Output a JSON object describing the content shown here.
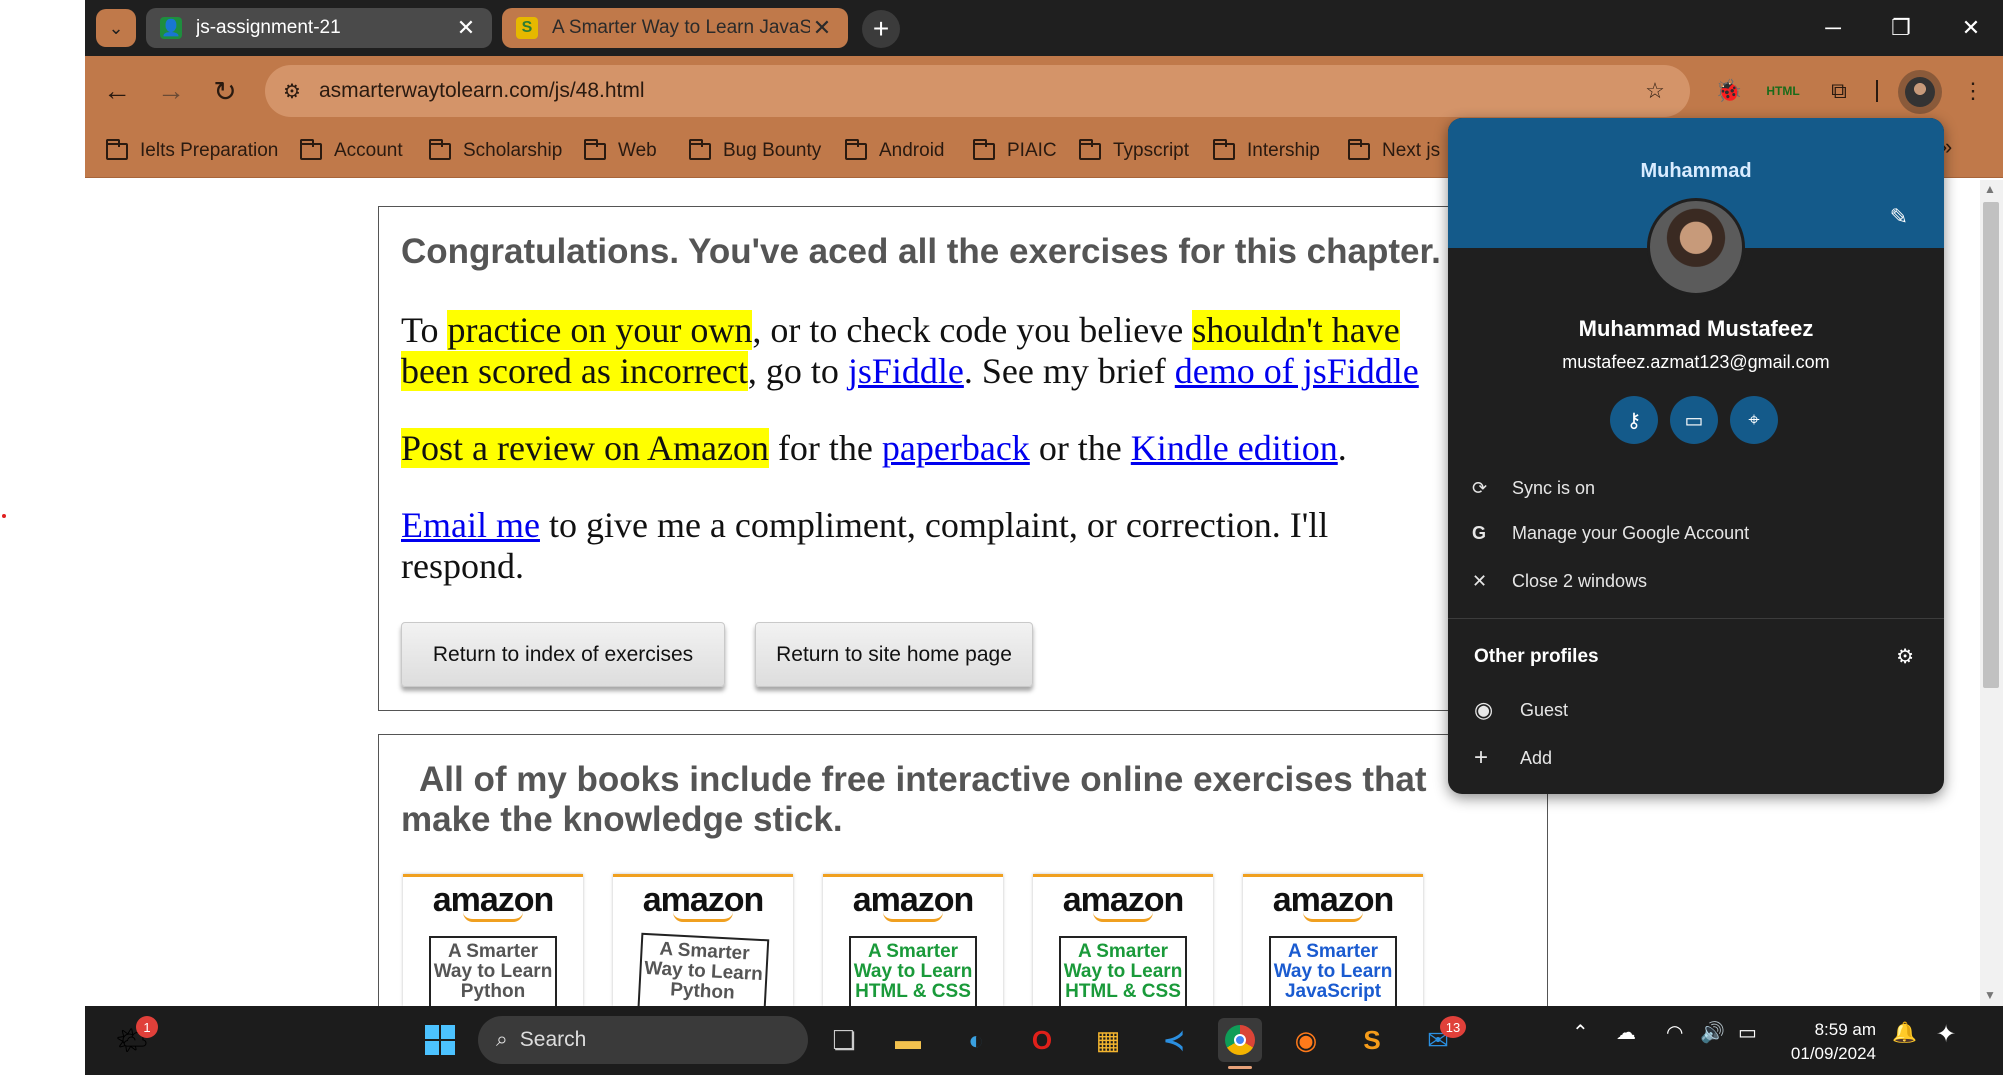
{
  "tabs": [
    {
      "title": "js-assignment-21",
      "favicon": "google-classroom-icon"
    },
    {
      "title": "A Smarter Way to Learn JavaScr",
      "favicon": "smarter-way-icon"
    }
  ],
  "omnibox": {
    "url": "asmarterwaytolearn.com/js/48.html"
  },
  "bookmarks": [
    "Ielts Preparation",
    "Account",
    "Scholarship",
    "Web",
    "Bug Bounty",
    "Android",
    "PIAIC",
    "Typscript",
    "Intership",
    "Next js"
  ],
  "page": {
    "congrats": "Congratulations. You've aced all the exercises for this chapter.",
    "p1": {
      "a": "To ",
      "hl1": "practice on your own",
      "b": ", or to check code you believe ",
      "hl2": "shouldn't have",
      "hl3": "been scored as incorrect",
      "c": ", go to ",
      "link1": "jsFiddle",
      "d": ". See my brief ",
      "link2": "demo of jsFiddle"
    },
    "p2": {
      "hl": "Post a review on Amazon",
      "a": " for the ",
      "link1": "paperback",
      "b": " or the ",
      "link2": "Kindle edition",
      "c": "."
    },
    "p3": {
      "link": "Email me",
      "text": " to give me a compliment, complaint, or correction. I'll respond."
    },
    "buttons": {
      "index": "Return to index of exercises",
      "home": "Return to site home page"
    },
    "books_heading": "All of my books include free interactive online exercises that make the knowledge stick.",
    "books": [
      {
        "brand": "amazon",
        "cover": "A Smarter Way to Learn Python",
        "cover_color": "#555555"
      },
      {
        "brand": "amazon",
        "cover": "A Smarter Way to Learn Python",
        "cover_color": "#555555"
      },
      {
        "brand": "amazon",
        "cover": "A Smarter Way to Learn HTML & CSS",
        "cover_color": "#1a9a3a"
      },
      {
        "brand": "amazon",
        "cover": "A Smarter Way to Learn HTML & CSS",
        "cover_color": "#1a9a3a"
      },
      {
        "brand": "amazon",
        "cover": "A Smarter Way to Learn JavaScript",
        "cover_color": "#1a5bd0"
      }
    ]
  },
  "profile": {
    "header_name": "Muhammad",
    "full_name": "Muhammad Mustafeez",
    "email": "mustafeez.azmat123@gmail.com",
    "menu": [
      "Sync is on",
      "Manage your Google Account",
      "Close 2 windows"
    ],
    "other_profiles_title": "Other profiles",
    "other": [
      "Guest",
      "Add"
    ]
  },
  "taskbar": {
    "search_placeholder": "Search",
    "weather_badge": "1",
    "store_badge": "13",
    "time": "8:59 am",
    "date": "01/09/2024"
  },
  "colors": {
    "accent": "#c0794a",
    "profile_banner": "#145a8a",
    "highlight": "#ffff00",
    "link": "#0000ee"
  }
}
